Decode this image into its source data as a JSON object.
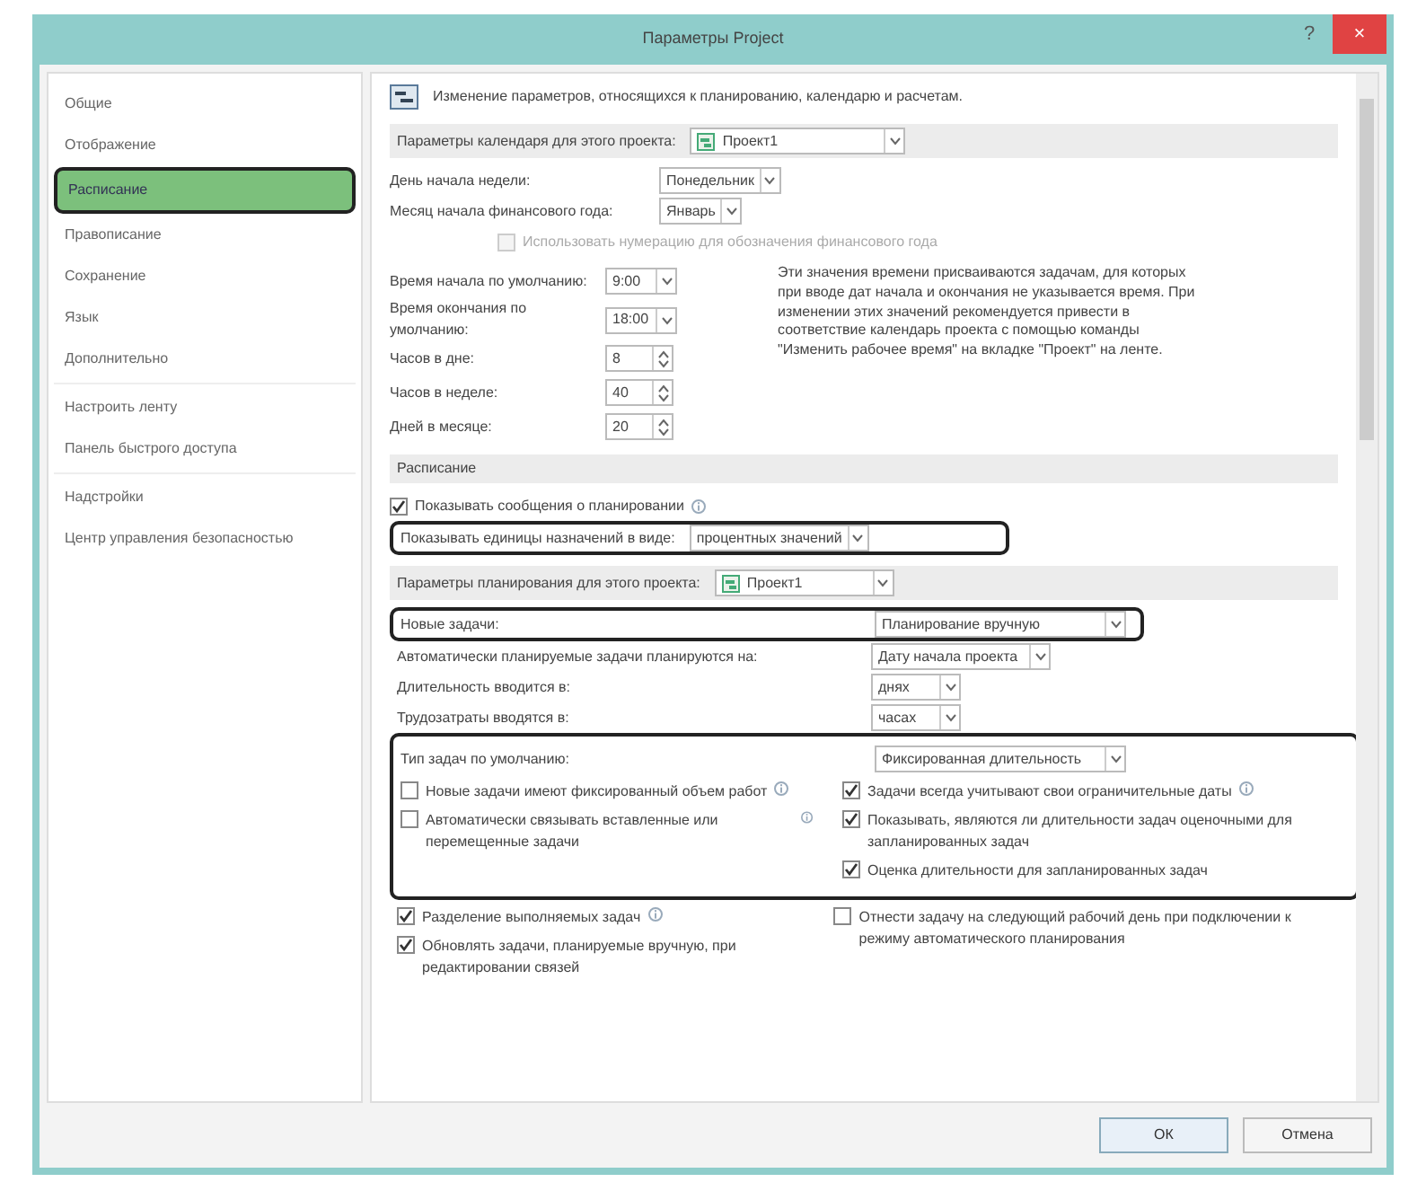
{
  "window": {
    "title": "Параметры Project",
    "help": "?",
    "close": "×"
  },
  "nav": [
    {
      "label": "Общие",
      "selected": false,
      "highlighted": false
    },
    {
      "label": "Отображение",
      "selected": false,
      "highlighted": false
    },
    {
      "label": "Расписание",
      "selected": true,
      "highlighted": true
    },
    {
      "label": "Правописание",
      "selected": false,
      "highlighted": false
    },
    {
      "label": "Сохранение",
      "selected": false,
      "highlighted": false
    },
    {
      "label": "Язык",
      "selected": false,
      "highlighted": false
    },
    {
      "label": "Дополнительно",
      "selected": false,
      "highlighted": false
    },
    {
      "label": "Настроить ленту",
      "selected": false,
      "highlighted": false
    },
    {
      "label": "Панель быстрого доступа",
      "selected": false,
      "highlighted": false
    },
    {
      "label": "Надстройки",
      "selected": false,
      "highlighted": false
    },
    {
      "label": "Центр управления безопасностью",
      "selected": false,
      "highlighted": false
    }
  ],
  "header": "Изменение параметров, относящихся к планированию, календарю и расчетам.",
  "calendar": {
    "label": "Параметры календаря для этого проекта:",
    "value": "Проект1",
    "top_fields": [
      {
        "label": "День начала недели:",
        "value": "Понедельник"
      },
      {
        "label": "Месяц начала финансового года:",
        "value": "Январь"
      }
    ],
    "fiscal": {
      "label": "Использовать нумерацию для обозначения финансового года",
      "checked": false,
      "disabled": true
    },
    "fields": [
      {
        "kind": "select",
        "label": "Время начала по умолчанию:",
        "value": "9:00"
      },
      {
        "kind": "select",
        "label": "Время окончания по умолчанию:",
        "value": "18:00"
      },
      {
        "kind": "spin",
        "label": "Часов в дне:",
        "value": "8"
      },
      {
        "kind": "spin",
        "label": "Часов в неделе:",
        "value": "40"
      },
      {
        "kind": "spin",
        "label": "Дней в месяце:",
        "value": "20"
      }
    ],
    "note": "Эти значения времени присваиваются задачам, для которых при вводе дат начала и окончания не указывается время. При изменении этих значений рекомендуется привести в соответствие календарь проекта с помощью команды \"Изменить рабочее время\" на вкладке \"Проект\" на ленте."
  },
  "schedule": {
    "title": "Расписание",
    "messages": {
      "label": "Показывать сообщения о планировании",
      "checked": true
    },
    "units": {
      "label": "Показывать единицы назначений в виде:",
      "value": "процентных значений",
      "highlighted": true
    }
  },
  "planning": {
    "label": "Параметры планирования для этого проекта:",
    "value": "Проект1",
    "fields": [
      {
        "label": "Новые задачи:",
        "value": "Планирование вручную",
        "highlighted": true
      },
      {
        "label": "Автоматически планируемые задачи планируются на:",
        "value": "Дату начала проекта",
        "highlighted": false
      },
      {
        "label": "Длительность вводится в:",
        "value": "днях",
        "highlighted": false
      },
      {
        "label": "Трудозатраты вводятся в:",
        "value": "часах",
        "highlighted": false
      }
    ],
    "group": {
      "highlighted": true,
      "label": "Тип задач по умолчанию:",
      "value": "Фиксированная длительность",
      "left": [
        {
          "label": "Новые задачи имеют фиксированный объем работ",
          "checked": false,
          "info": true
        },
        {
          "label": "Автоматически связывать вставленные или перемещенные задачи",
          "checked": false,
          "info": true
        }
      ],
      "right": [
        {
          "label": "Задачи всегда учитывают свои ограничительные даты",
          "checked": true,
          "info": true
        },
        {
          "label": "Показывать, являются ли длительности задач оценочными для запланированных задач",
          "checked": true,
          "info": false
        },
        {
          "label": "Оценка длительности для запланированных задач",
          "checked": true,
          "info": false
        }
      ]
    },
    "extra_left": [
      {
        "label": "Разделение выполняемых задач",
        "checked": true,
        "info": true
      },
      {
        "label": "Обновлять задачи, планируемые вручную, при редактировании связей",
        "checked": true,
        "info": false
      }
    ],
    "extra_right": [
      {
        "label": "Отнести задачу на следующий рабочий день при подключении к режиму автоматического планирования",
        "checked": false,
        "info": false
      }
    ]
  },
  "buttons": [
    {
      "label": "ОК",
      "default": true
    },
    {
      "label": "Отмена",
      "default": false
    }
  ]
}
